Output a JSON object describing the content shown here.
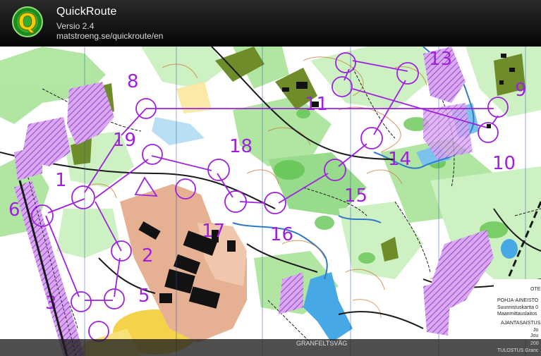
{
  "app": {
    "title": "QuickRoute",
    "version": "Versio 2.4",
    "url": "matstroeng.se/quickroute/en"
  },
  "colors": {
    "course": "#b020e0",
    "water": "#3aa0e0",
    "forest_green": "#9de08a",
    "yellow_open": "#f5d84a",
    "olive": "#6e8a2a",
    "urban": "#e8b098",
    "building": "#111111",
    "contour": "#c87a3a"
  },
  "controls": [
    {
      "number": "1"
    },
    {
      "number": "2"
    },
    {
      "number": "3"
    },
    {
      "number": "5"
    },
    {
      "number": "6"
    },
    {
      "number": "8"
    },
    {
      "number": "9"
    },
    {
      "number": "10"
    },
    {
      "number": "11"
    },
    {
      "number": "13"
    },
    {
      "number": "14"
    },
    {
      "number": "15"
    },
    {
      "number": "16"
    },
    {
      "number": "17"
    },
    {
      "number": "18"
    },
    {
      "number": "19"
    }
  ],
  "map_text": {
    "ote": "OTE",
    "pohja": "POHJA-AINEISTO",
    "suunnistus": "Suunnistuskartta 0",
    "maanmittaus": "Maanmittauslaitos",
    "ajantasaistus": "AJANTASAISTUS",
    "jo1": "Jo",
    "jo2": "Jou",
    "year": "200",
    "tulostus": "TULOSTUS Granc",
    "street": "GRANFELTSVÄG"
  }
}
